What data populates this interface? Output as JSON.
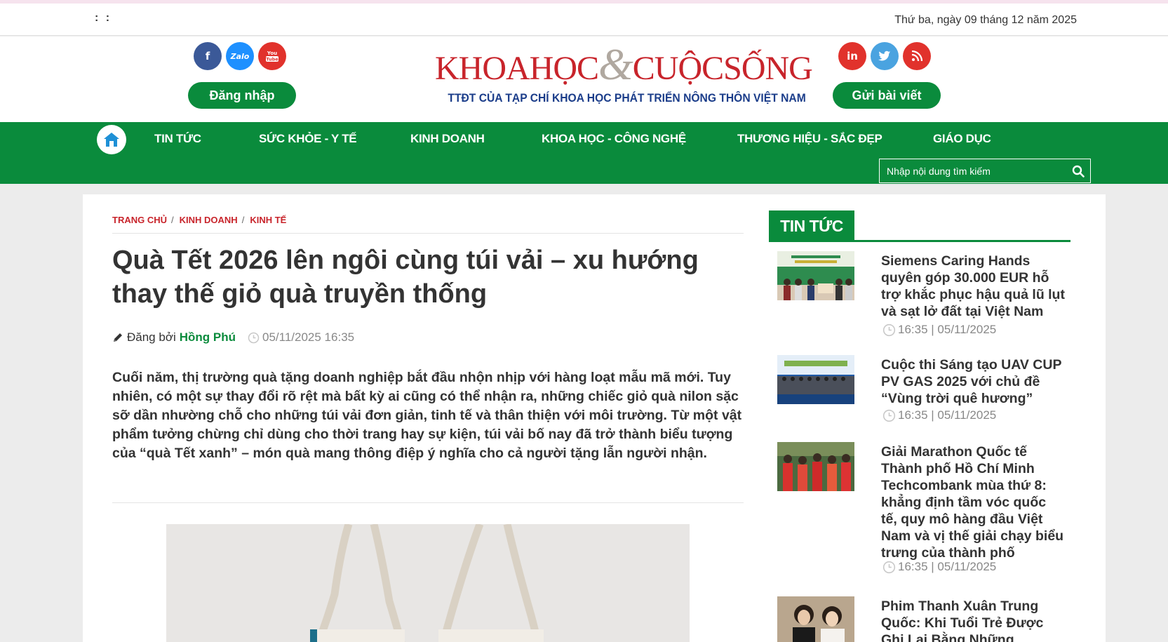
{
  "topbar": {
    "dots": ": :",
    "date": "Thứ ba, ngày 09 tháng 12 năm 2025"
  },
  "header": {
    "logo_part1": "KHOAHỌC",
    "logo_amp": "&",
    "logo_part2": "CUỘCSỐNG",
    "logo_sub": "TTĐT CỦA TẠP CHÍ KHOA HỌC PHÁT TRIỂN NÔNG THÔN VIỆT NAM",
    "login_label": "Đăng nhập",
    "submit_label": "Gửi bài viết",
    "social_left": [
      {
        "icon": "facebook-icon",
        "glyph": "f"
      },
      {
        "icon": "zalo-icon",
        "glyph": "Zalo"
      },
      {
        "icon": "youtube-icon",
        "glyph": "You Tube"
      }
    ],
    "social_right": [
      {
        "icon": "linkedin-icon",
        "glyph": "in"
      },
      {
        "icon": "twitter-icon",
        "glyph": ""
      },
      {
        "icon": "rss-icon",
        "glyph": ""
      }
    ]
  },
  "nav": {
    "items": [
      "TIN TỨC",
      "SỨC KHỎE - Y TẾ",
      "KINH DOANH",
      "KHOA HỌC - CÔNG NGHỆ",
      "THƯƠNG HIỆU - SẮC ĐẸP",
      "GIÁO DỤC"
    ],
    "search_placeholder": "Nhập nội dung tìm kiếm"
  },
  "article": {
    "breadcrumbs": [
      "TRANG CHỦ",
      "KINH DOANH",
      "KINH TẾ"
    ],
    "title": "Quà Tết 2026 lên ngôi cùng túi vải – xu hướng thay thế giỏ quà truyền thống",
    "posted_by_label": "Đăng bởi",
    "author": "Hồng Phú",
    "datetime": "05/11/2025 16:35",
    "lead": "Cuối năm, thị trường quà tặng doanh nghiệp bắt đầu nhộn nhịp với hàng loạt mẫu mã mới. Tuy nhiên, có một sự thay đổi rõ rệt mà bất kỳ ai cũng có thể nhận ra, những chiếc giỏ quà nilon sặc sỡ dần nhường chỗ cho những túi vải đơn giản, tinh tế và thân thiện với môi trường. Từ một vật phẩm tưởng chừng chỉ dùng cho thời trang hay sự kiện, túi vải bố nay đã trở thành biểu tượng của “quà Tết xanh” – món quà mang thông điệp ý nghĩa cho cả người tặng lẫn người nhận."
  },
  "sidebar": {
    "heading": "TIN TỨC",
    "news": [
      {
        "title": "Siemens Caring Hands quyên góp 30.000 EUR hỗ trợ khắc phục hậu quả lũ lụt và sạt lở đất tại Việt Nam",
        "time": "16:35 | 05/11/2025"
      },
      {
        "title": "Cuộc thi Sáng tạo UAV CUP PV GAS 2025 với chủ đề “Vùng trời quê hương”",
        "time": "16:35 | 05/11/2025"
      },
      {
        "title": "Giải Marathon Quốc tế Thành phố Hồ Chí Minh Techcombank mùa thứ 8: khẳng định tầm vóc quốc tế, quy mô hàng đầu Việt Nam và vị thế giải chạy biểu trưng của thành phố",
        "time": "16:35 | 05/11/2025"
      },
      {
        "title": "Phim Thanh Xuân Trung Quốc: Khi Tuổi Trẻ Được Ghi Lại Bằng Những Khoảnh",
        "time": ""
      }
    ]
  },
  "colors": {
    "brand_green": "#0a8b3c",
    "logo_red": "#c8242b",
    "logo_blue": "#1b3d8a"
  }
}
